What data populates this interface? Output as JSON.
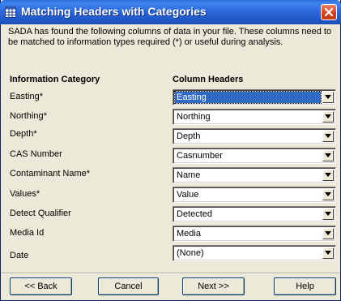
{
  "window": {
    "title": "Matching Headers with Categories",
    "icons": {
      "app": "grid-window-icon",
      "close": "close-icon"
    }
  },
  "description": "SADA has found the following columns of data in your file. These columns need to be matched to information types  required (*) or  useful during analysis.",
  "headers": {
    "category": "Information Category",
    "column": "Column Headers"
  },
  "rows": [
    {
      "label": "Easting*",
      "value": "Easting"
    },
    {
      "label": "Northing*",
      "value": "Northing"
    },
    {
      "label": "Depth*",
      "value": "Depth"
    },
    {
      "label": "CAS Number",
      "value": "Casnumber"
    },
    {
      "label": "Contaminant Name*",
      "value": "Name"
    },
    {
      "label": "Values*",
      "value": "Value"
    },
    {
      "label": "Detect Qualifier",
      "value": "Detected"
    },
    {
      "label": "Media Id",
      "value": "Media"
    },
    {
      "label": "Date",
      "value": "(None)"
    }
  ],
  "buttons": {
    "back": "<< Back",
    "cancel": "Cancel",
    "next": "Next >>",
    "help": "Help"
  },
  "colors": {
    "titlebar": "#2a66d9",
    "dialog_bg": "#ece9d8",
    "selection": "#316ac5"
  }
}
